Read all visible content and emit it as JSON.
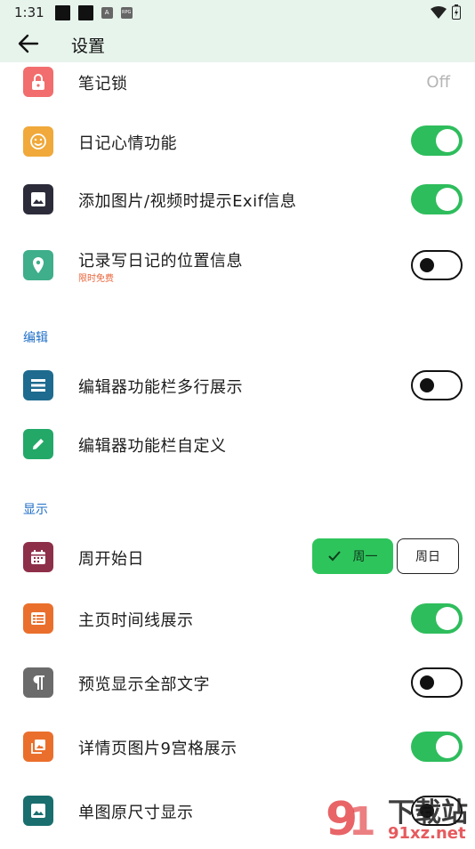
{
  "status_bar": {
    "time": "1:31",
    "mini_icon_a": "A",
    "mini_icon_b": "RPG"
  },
  "app_bar": {
    "title": "设置"
  },
  "items": {
    "note_lock": {
      "label": "笔记锁",
      "value": "Off",
      "icon": "lock-icon",
      "color": "#f26d6d"
    },
    "diary_mood": {
      "label": "日记心情功能",
      "icon": "smile-icon",
      "color": "#f0a93a",
      "enabled": true
    },
    "exif_prompt": {
      "label": "添加图片/视频时提示Exif信息",
      "icon": "image-icon",
      "color": "#2b2b3a",
      "enabled": true
    },
    "location": {
      "label": "记录写日记的位置信息",
      "sub": "限时免费",
      "icon": "location-pin-icon",
      "color": "#3fae8a",
      "enabled": false
    },
    "toolbar_multiline": {
      "label": "编辑器功能栏多行展示",
      "icon": "list-icon",
      "color": "#1e6b8f",
      "enabled": false
    },
    "toolbar_custom": {
      "label": "编辑器功能栏自定义",
      "icon": "pencil-icon",
      "color": "#23a868"
    },
    "week_start": {
      "label": "周开始日",
      "icon": "calendar-icon",
      "color": "#8e2f4a",
      "options": [
        "周一",
        "周日"
      ],
      "selected": "周一"
    },
    "timeline": {
      "label": "主页时间线展示",
      "icon": "table-icon",
      "color": "#ea6f2c",
      "enabled": true
    },
    "preview_all": {
      "label": "预览显示全部文字",
      "icon": "paragraph-icon",
      "color": "#6b6b6b",
      "enabled": false
    },
    "grid9": {
      "label": "详情页图片9宫格展示",
      "icon": "gallery-icon",
      "color": "#ea6f2c",
      "enabled": true
    },
    "original_size": {
      "label": "单图原尺寸显示",
      "icon": "image-icon",
      "color": "#1a6e6e",
      "enabled": false
    }
  },
  "sections": {
    "edit": "编辑",
    "display": "显示"
  },
  "watermark": {
    "text": "下载站",
    "url_text": "91xz.net"
  }
}
